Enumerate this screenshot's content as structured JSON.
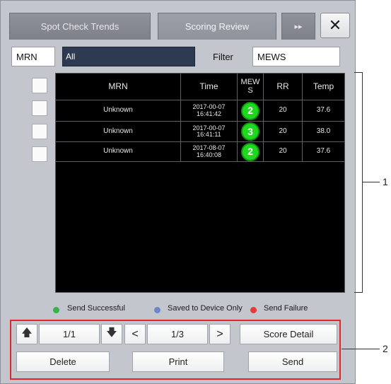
{
  "tabs": [
    {
      "label": "Spot Check Trends",
      "active": false
    },
    {
      "label": "Scoring Review",
      "active": true
    }
  ],
  "tab_more_glyph": "▸▸",
  "close_glyph": "✕",
  "filter_row": {
    "mrn_label": "MRN",
    "mrn_value": "All",
    "filter_label": "Filter",
    "filter_value": "MEWS"
  },
  "table": {
    "headers": {
      "mrn": "MRN",
      "time": "Time",
      "score": "MEW\nS",
      "rr": "RR",
      "temp": "Temp"
    },
    "rows": [
      {
        "mrn": "Unknown",
        "time": "2017-00-07\n16:41:42",
        "score": "2",
        "rr": "20",
        "temp": "37.6"
      },
      {
        "mrn": "Unknown",
        "time": "2017-00-07\n16:41:11",
        "score": "3",
        "rr": "20",
        "temp": "38.0"
      },
      {
        "mrn": "Unknown",
        "time": "2017-08-07\n16:40:08",
        "score": "2",
        "rr": "20",
        "temp": "37.6"
      }
    ]
  },
  "legend": [
    {
      "label": "Send Successful",
      "color": "#33b34a"
    },
    {
      "label": "Saved to Device Only",
      "color": "#6a87c8"
    },
    {
      "label": "Send Failure",
      "color": "#e33b3b"
    }
  ],
  "nav": {
    "page_value": "1/1",
    "record_value": "1/3",
    "prev_glyph": "<",
    "next_glyph": ">",
    "up_glyph": "🡅",
    "down_glyph": "🡇",
    "score_detail_label": "Score Detail",
    "delete_label": "Delete",
    "print_label": "Print",
    "send_label": "Send"
  },
  "callouts": {
    "table": "1",
    "buttons": "2"
  },
  "colors": {
    "score_badge": "#20d820",
    "annotation_box": "#e0282a"
  }
}
